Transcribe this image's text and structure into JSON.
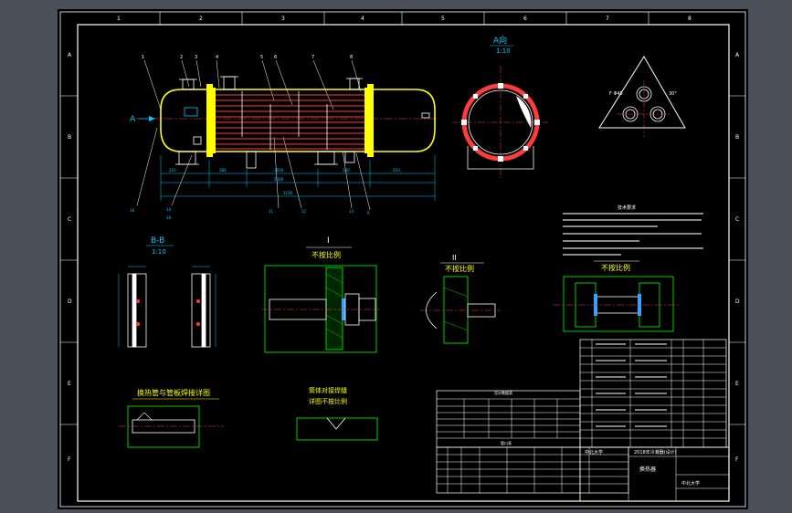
{
  "border_letters_left": [
    "A",
    "B",
    "C",
    "D",
    "E",
    "F"
  ],
  "border_letters_right": [
    "A",
    "B",
    "C",
    "D",
    "E",
    "F"
  ],
  "border_numbers_top": [
    "1",
    "2",
    "3",
    "4",
    "5",
    "6",
    "7",
    "8"
  ],
  "views": {
    "main_arrow": "A",
    "a_view_title": "A向",
    "a_view_scale": "1:10",
    "bb_title": "B-B",
    "bb_scale": "1:10",
    "detail1_title": "I",
    "detail1_scale": "不按比例",
    "detail2_title": "II",
    "detail2_scale": "不按比例",
    "detail3_scale": "不按比例",
    "tube_weld_title": "换热管与管板焊接详图",
    "shell_weld_title1": "筒体对接焊缝",
    "shell_weld_title2": "详图不按比例",
    "tech_req_title": "技术要求",
    "design_data_title": "设计数据表",
    "nozzle_table_title": "管口表",
    "school": "中北大学",
    "title_name": "换热器",
    "drawing_name": "2018年冷凝器(设计)"
  },
  "colors": {
    "background": "#4a4f58",
    "paper": "#000000",
    "frame": "#ffffff",
    "vessel": "#ffff00",
    "tube": "#ff3b3b",
    "center_line": "#ff3b3b",
    "dimension": "#00c8ff",
    "detail_frame": "#00ff00",
    "text_yellow": "#ffff00",
    "table_line": "#ffffff"
  },
  "icons": {
    "section_arrow": "arrow-right-icon"
  }
}
